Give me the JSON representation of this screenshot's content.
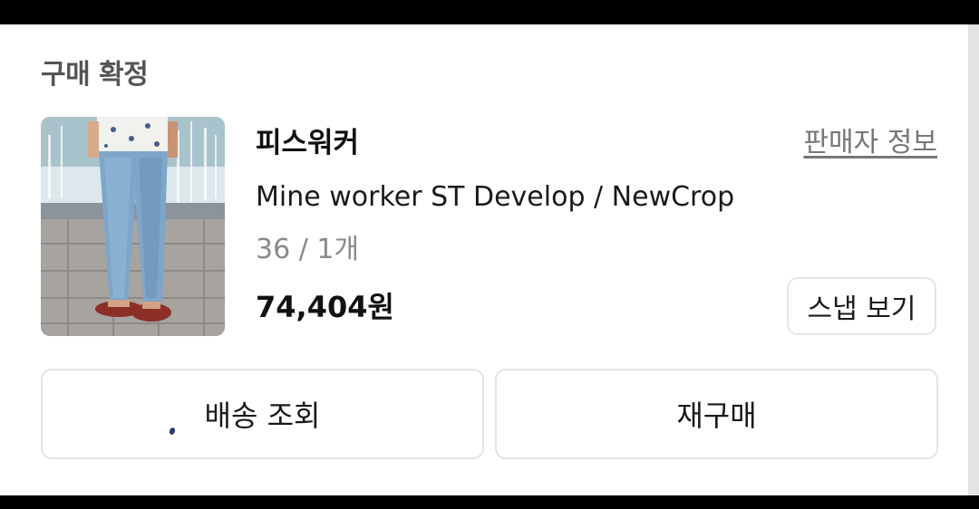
{
  "order": {
    "status": "구매 확정",
    "seller_link": "판매자 정보"
  },
  "product": {
    "brand": "피스워커",
    "name": "Mine worker ST Develop / NewCrop",
    "option": "36 / 1개",
    "price": "74,404원",
    "image": "product-photo-jeans-sandals"
  },
  "buttons": {
    "snap": "스냅 보기",
    "track": "배송 조회",
    "rebuy": "재구매"
  }
}
